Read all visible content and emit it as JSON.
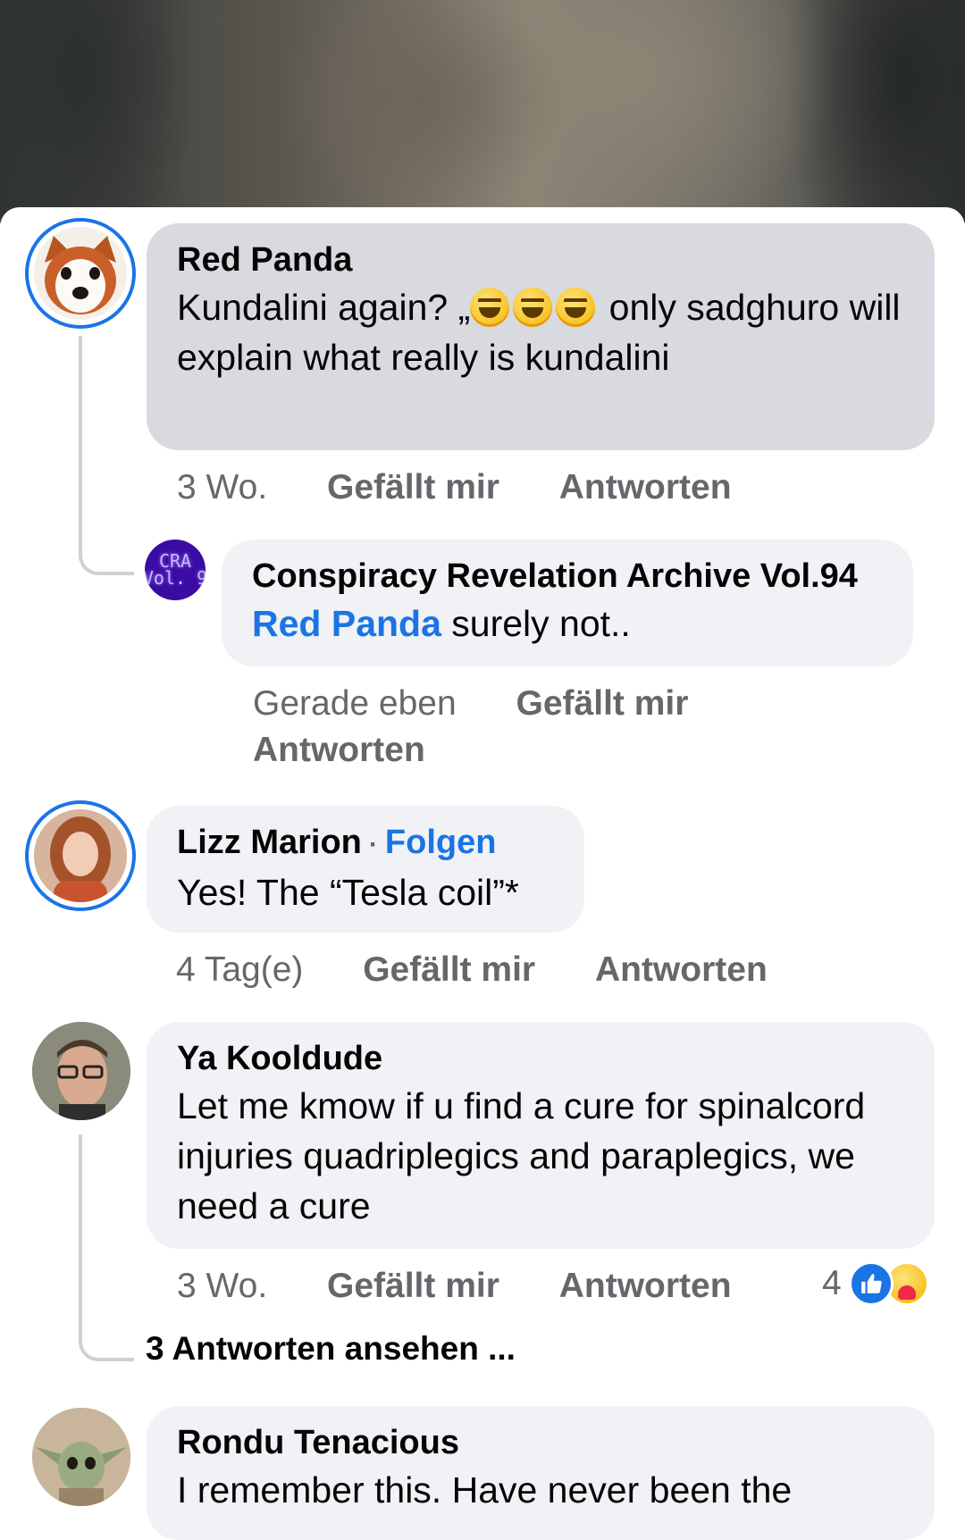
{
  "comments": [
    {
      "author": "Red Panda",
      "text_before": "Kundalini again? „",
      "text_after": " only sadghuro will explain what really is kundalini",
      "emojis": [
        "grinning-squinting-face-icon",
        "grinning-squinting-face-icon",
        "grinning-squinting-face-icon"
      ],
      "time": "3 Wo.",
      "like": "Gefällt mir",
      "reply": "Antworten",
      "reply_item": {
        "author": "Conspiracy Revelation Archive Vol.94",
        "avatar_text": "CRA\nVol. 9",
        "mention": "Red Panda",
        "text": " surely not..",
        "time": "Gerade eben",
        "like": "Gefällt mir",
        "reply": "Antworten"
      }
    },
    {
      "author": "Lizz Marion",
      "follow": "Folgen",
      "separator": "·",
      "text": "Yes! The “Tesla coil”*",
      "time": "4 Tag(e)",
      "like": "Gefällt mir",
      "reply": "Antworten"
    },
    {
      "author": "Ya Kooldude",
      "text": "Let me kmow if u find a cure for spinalcord injuries quadriplegics and paraplegics, we need a cure",
      "time": "3 Wo.",
      "like": "Gefällt mir",
      "reply": "Antworten",
      "reaction_count": "4",
      "reactions": [
        "like-icon",
        "care-icon"
      ],
      "view_replies": "3 Antworten ansehen ..."
    },
    {
      "author": "Rondu Tenacious",
      "text": "I remember this. Have never been the"
    }
  ],
  "colors": {
    "accent": "#1b74e4",
    "bubble": "#f0f2f5",
    "bubble_highlight": "#d8dadf",
    "meta": "#65676b"
  }
}
